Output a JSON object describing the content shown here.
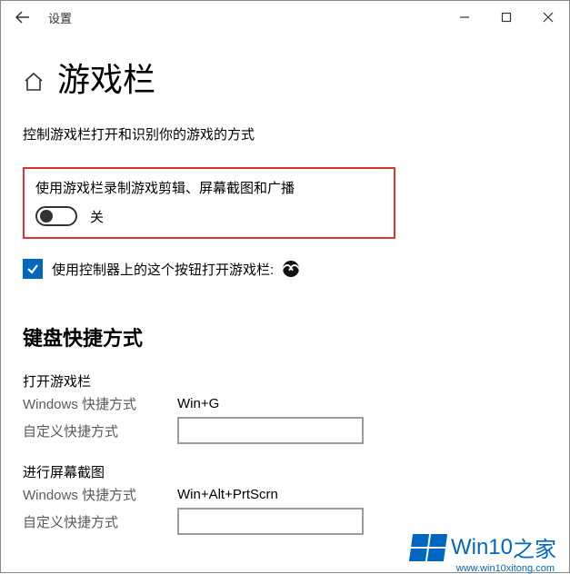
{
  "titlebar": {
    "title": "设置"
  },
  "header": {
    "title": "游戏栏"
  },
  "description": "控制游戏栏打开和识别你的游戏的方式",
  "highlight": {
    "label": "使用游戏栏录制游戏剪辑、屏幕截图和广播",
    "state": "关"
  },
  "checkbox": {
    "label": "使用控制器上的这个按钮打开游戏栏:"
  },
  "shortcuts": {
    "heading": "键盘快捷方式",
    "groups": [
      {
        "title": "打开游戏栏",
        "win_label": "Windows 快捷方式",
        "win_value": "Win+G",
        "custom_label": "自定义快捷方式"
      },
      {
        "title": "进行屏幕截图",
        "win_label": "Windows 快捷方式",
        "win_value": "Win+Alt+PrtScrn",
        "custom_label": "自定义快捷方式"
      }
    ]
  },
  "watermark": {
    "brand": "Win10",
    "suffix": "之家",
    "url": "www.win10xitong.com"
  }
}
